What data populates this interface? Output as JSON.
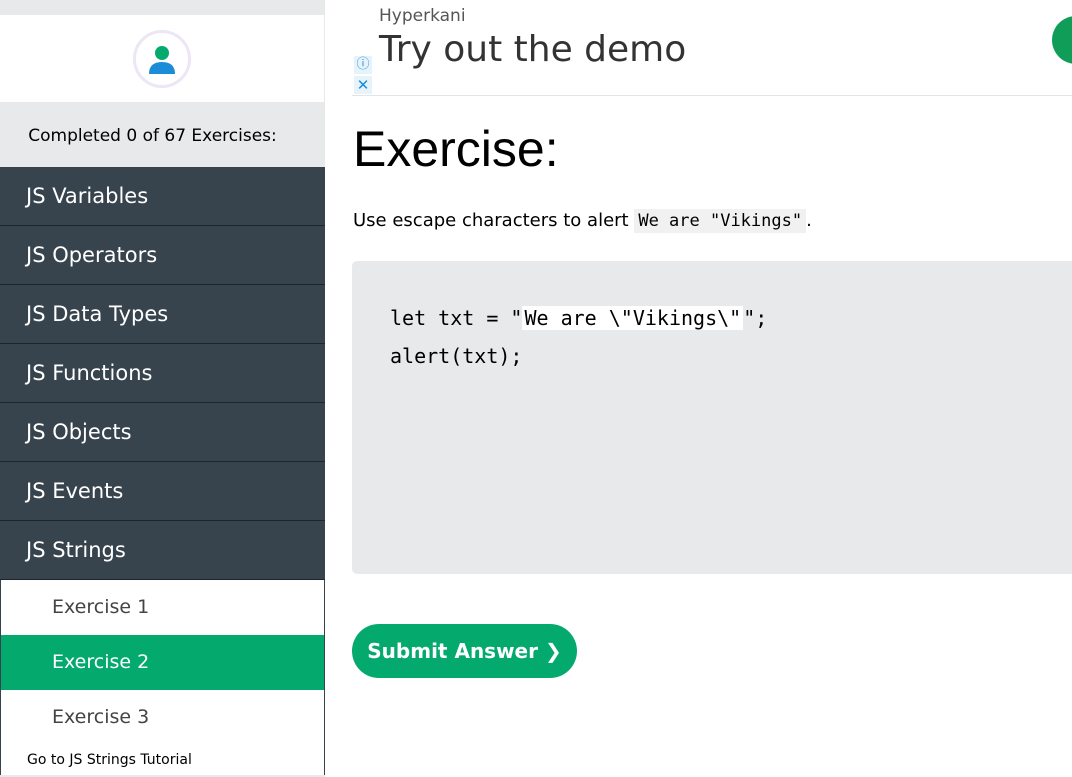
{
  "sidebar": {
    "progress_text": "Completed 0 of 67 Exercises:",
    "menu": [
      {
        "label": "JS Variables"
      },
      {
        "label": "JS Operators"
      },
      {
        "label": "JS Data Types"
      },
      {
        "label": "JS Functions"
      },
      {
        "label": "JS Objects"
      },
      {
        "label": "JS Events"
      },
      {
        "label": "JS Strings"
      }
    ],
    "submenu": [
      {
        "label": "Exercise 1"
      },
      {
        "label": "Exercise 2"
      },
      {
        "label": "Exercise 3"
      }
    ],
    "tutorial_link": "Go to JS Strings Tutorial"
  },
  "ad": {
    "sponsor": "Hyperkani",
    "headline": "Try out the demo"
  },
  "exercise": {
    "title": "Exercise:",
    "instruction_prefix": "Use escape characters to alert ",
    "instruction_code": "We are \"Vikings\"",
    "instruction_suffix": ".",
    "code_line1_prefix": "let txt = \"",
    "code_input_value": "We are \\\"Vikings\\\"",
    "code_line1_suffix": "\";",
    "code_line2": "alert(txt);",
    "submit_label": "Submit Answer ❯"
  },
  "colors": {
    "accent": "#04aa6d",
    "menu_bg": "#38444d"
  }
}
